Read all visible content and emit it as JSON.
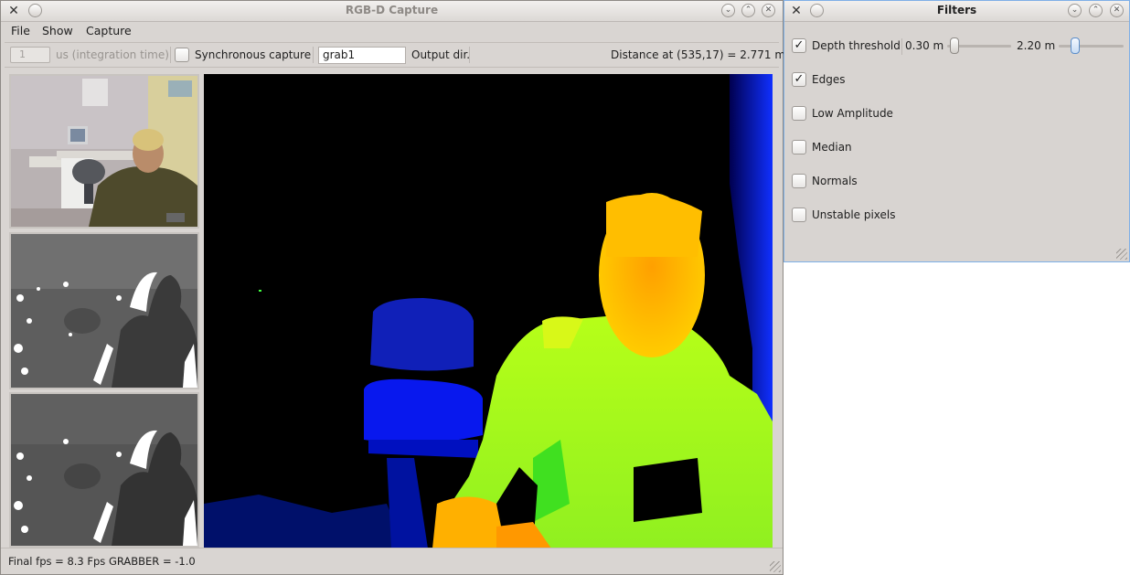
{
  "main_window": {
    "title": "RGB-D Capture",
    "app_icon": "x-logo-icon",
    "menu": [
      "File",
      "Show",
      "Capture"
    ],
    "toolbar": {
      "integration_value": "1",
      "integration_label": "us (integration time)",
      "sync_label": "Synchronous capture",
      "sync_checked": false,
      "output_dir_value": "grab1",
      "output_dir_label": "Output dir.",
      "distance_text": "Distance at (535,17) = 2.771 m"
    },
    "views": {
      "rgb": "color camera image: person at desk in office",
      "depth_gray_1": "grayscale depth image",
      "depth_gray_2": "grayscale depth image (filtered)",
      "depth_color": "color-mapped depth image"
    },
    "status": "Final fps = 8.3 Fps GRABBER = -1.0"
  },
  "filters_window": {
    "title": "Filters",
    "depth_threshold": {
      "label": "Depth threshold",
      "checked": true,
      "min_label": "0.30 m",
      "max_label": "2.20 m",
      "min_fraction": 0.08,
      "max_fraction": 0.27
    },
    "options": [
      {
        "label": "Edges",
        "checked": true
      },
      {
        "label": "Low Amplitude",
        "checked": false
      },
      {
        "label": "Median",
        "checked": false
      },
      {
        "label": "Normals",
        "checked": false
      },
      {
        "label": "Unstable pixels",
        "checked": false
      }
    ]
  },
  "colors": {
    "window_bg": "#d9d5d2",
    "slider_active": "#5b8dc9",
    "depth_near": "#ffb000",
    "depth_mid": "#a8ff10",
    "depth_far": "#0010c0"
  }
}
